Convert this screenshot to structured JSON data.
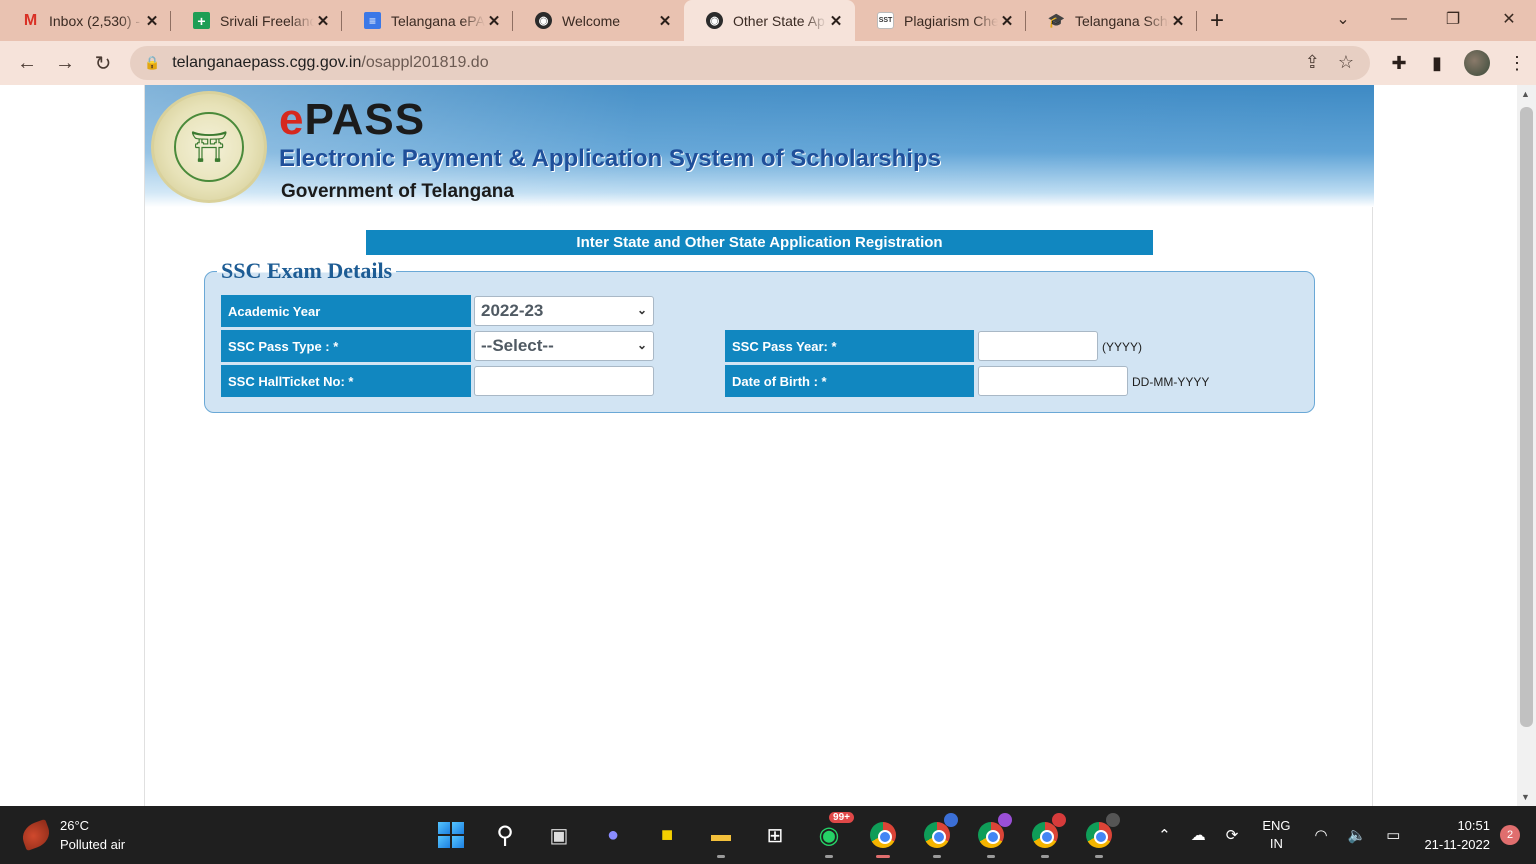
{
  "browser": {
    "tabs": [
      {
        "title": "Inbox (2,530) -",
        "favicon": "gmail-icon"
      },
      {
        "title": "Srivali Freelanc",
        "favicon": "sheets-icon"
      },
      {
        "title": "Telangana ePA",
        "favicon": "docs-icon"
      },
      {
        "title": "Welcome",
        "favicon": "globe-icon"
      },
      {
        "title": "Other State Ap",
        "favicon": "globe-icon",
        "active": true
      },
      {
        "title": "Plagiarism Che",
        "favicon": "sst-icon",
        "favicon_text": "SST"
      },
      {
        "title": "Telangana Scho",
        "favicon": "graduation-cap-icon"
      }
    ],
    "address": {
      "domain": "telanganaepass.cgg.gov.in",
      "path": "/osappl201819.do"
    }
  },
  "banner": {
    "brand_e": "e",
    "brand_pass": "PASS",
    "subtitle": "Electronic Payment & Application System of Scholarships",
    "government": "Government of Telangana"
  },
  "form": {
    "section_title": "Inter State and Other State Application Registration",
    "legend": "SSC Exam Details",
    "academic_year": {
      "label": "Academic Year",
      "value": "2022-23"
    },
    "ssc_pass_type": {
      "label": "SSC Pass Type : *",
      "value": "--Select--"
    },
    "ssc_pass_year": {
      "label": "SSC Pass Year: *",
      "value": "",
      "hint": "(YYYY)"
    },
    "hall_ticket": {
      "label": "SSC HallTicket No: *",
      "value": ""
    },
    "dob": {
      "label": "Date of Birth : *",
      "value": "",
      "hint": "DD-MM-YYYY"
    }
  },
  "taskbar": {
    "weather_temp": "26°C",
    "weather_desc": "Polluted air",
    "whatsapp_badge": "99+",
    "lang_top": "ENG",
    "lang_bottom": "IN",
    "time": "10:51",
    "date": "21-11-2022",
    "notifications": "2"
  },
  "colors": {
    "accent": "#1187c0",
    "tabstrip": "#e9c2b1",
    "form_bg": "#d2e4f3"
  }
}
